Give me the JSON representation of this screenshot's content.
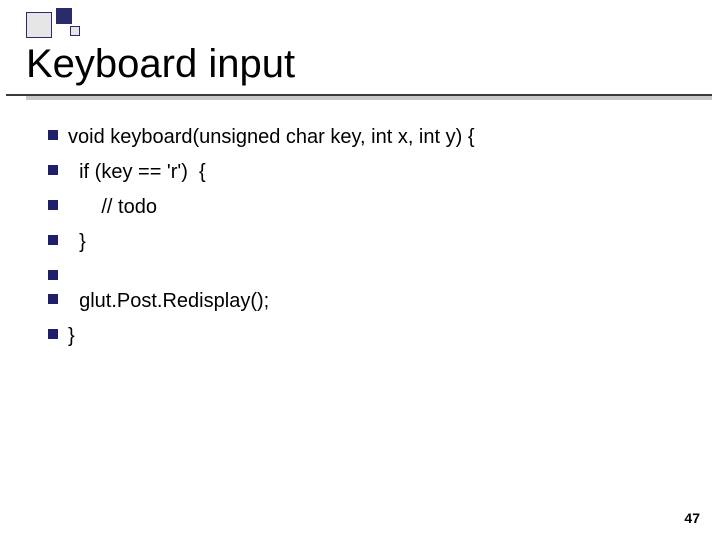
{
  "title": "Keyboard input",
  "bullets": [
    {
      "text": "void keyboard(unsigned char key, int x, int y) {"
    },
    {
      "text": "  if (key == 'r')  {"
    },
    {
      "text": "      // todo"
    },
    {
      "text": "  }"
    },
    {
      "text": ""
    },
    {
      "text": "  glut.Post.Redisplay();"
    },
    {
      "text": "}"
    }
  ],
  "page_number": "47"
}
